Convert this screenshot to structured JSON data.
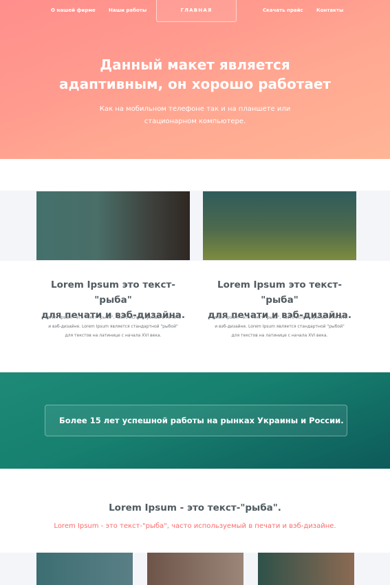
{
  "nav": {
    "items": [
      "О нашей фирме",
      "Наши работы",
      "Скачать прайс",
      "Контакты"
    ],
    "home_label": "ГЛАВНАЯ"
  },
  "hero": {
    "title_line1": "Данный макет является",
    "title_line2": "адаптивным, он хорошо работает",
    "subtitle_line1": "Как на мобильном телефоне так и на планшете или",
    "subtitle_line2": "стационарном компьютере.",
    "gradient_colors": [
      "#ff9a8c",
      "#ffb596"
    ]
  },
  "cards": [
    {
      "title_line1": "Lorem Ipsum это текст-\"рыба\"",
      "title_line2": "для печати и вэб-дизайна.",
      "text_line1": "Lorem Ipsum - это текст-\"рыба\", часто используемый в печати",
      "text_line2": "и вэб-дизайне. Lorem Ipsum является стандартной \"рыбой\"",
      "text_line3": "для текстов на латинице с начала XVI века."
    },
    {
      "title_line1": "Lorem Ipsum это текст-\"рыба\"",
      "title_line2": "для печати и вэб-дизайна.",
      "text_line1": "Lorem Ipsum - это текст-\"рыба\", часто используемый в печати",
      "text_line2": "и вэб-дизайне. Lorem Ipsum является стандартной \"рыбой\"",
      "text_line3": "для текстов на латинице с начала XVI века."
    }
  ],
  "banner": {
    "text": "Более 15 лет успешной работы на рынках Украины и России.",
    "color": "#17806f"
  },
  "bottom": {
    "title": "Lorem Ipsum - это текст-\"рыба\".",
    "subtitle": "Lorem Ipsum - это текст-\"рыба\", часто используемый в печати и вэб-дизайне.",
    "accent_color": "#ff6b6b"
  }
}
